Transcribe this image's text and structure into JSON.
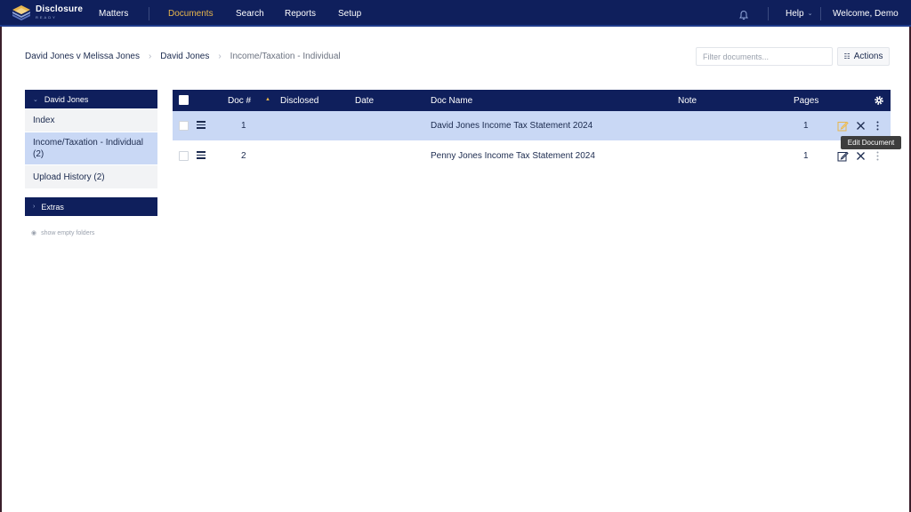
{
  "app": {
    "logo_title": "Disclosure",
    "logo_sub": "READY"
  },
  "nav": {
    "items": [
      {
        "label": "Matters",
        "active": false
      },
      {
        "label": "Documents",
        "active": true
      },
      {
        "label": "Search",
        "active": false
      },
      {
        "label": "Reports",
        "active": false
      },
      {
        "label": "Setup",
        "active": false
      }
    ],
    "help": "Help",
    "welcome": "Welcome, Demo"
  },
  "breadcrumb": [
    "David Jones v Melissa Jones",
    "David Jones",
    "Income/Taxation - Individual"
  ],
  "toolbar": {
    "filter_placeholder": "Filter documents...",
    "actions_label": "Actions"
  },
  "sidebar": {
    "header": "David Jones",
    "items": [
      {
        "label": "Index",
        "active": false
      },
      {
        "label": "Income/Taxation - Individual (2)",
        "active": true
      },
      {
        "label": "Upload History (2)",
        "active": false
      }
    ],
    "extras": "Extras",
    "show_empty": "show empty folders"
  },
  "table": {
    "columns": [
      "Doc #",
      "Disclosed",
      "Date",
      "Doc Name",
      "Note",
      "Pages"
    ],
    "rows": [
      {
        "doc_num": "1",
        "disclosed": "",
        "date": "",
        "doc_name": "David Jones Income Tax Statement 2024",
        "note": "",
        "pages": "1",
        "selected": true
      },
      {
        "doc_num": "2",
        "disclosed": "",
        "date": "",
        "doc_name": "Penny Jones Income Tax Statement 2024",
        "note": "",
        "pages": "1",
        "selected": false
      }
    ]
  },
  "tooltip": "Edit Document",
  "colors": {
    "navbar": "#0f1f5c",
    "accent": "#e8b64c",
    "selected_row": "#c9d8f5"
  }
}
